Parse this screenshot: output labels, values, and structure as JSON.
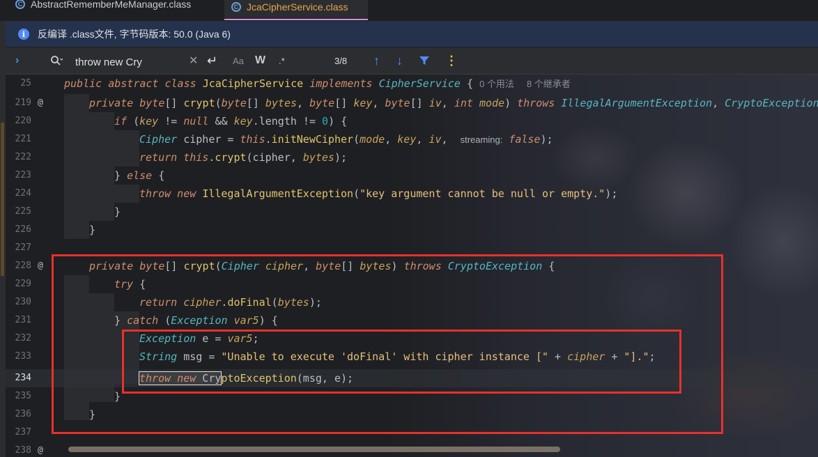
{
  "tabs": [
    {
      "label": "AbstractRememberMeManager.class",
      "icon": "class-file-icon"
    },
    {
      "label": "JcaCipherService.class",
      "icon": "class-file-icon",
      "active": true
    }
  ],
  "banner": {
    "text": "反编译 .class文件, 字节码版本: 50.0 (Java 6)",
    "icon": "info-icon"
  },
  "find": {
    "query": "throw new Cry",
    "match_case_label": "Aa",
    "words_label": "W",
    "regex_label": ".*",
    "counter": "3/8"
  },
  "colors": {
    "accent": "#548af7",
    "highlight_box": "#e8312b",
    "active_tab_underline": "#d08dd9"
  },
  "code": {
    "class_line": {
      "num": "25",
      "meta_usages": "0 个用法",
      "meta_inheritors": "8 个继承者"
    },
    "lines": [
      {
        "num": "219",
        "gutter": "@"
      },
      {
        "num": "220"
      },
      {
        "num": "221",
        "hint": "streaming:"
      },
      {
        "num": "222"
      },
      {
        "num": "223"
      },
      {
        "num": "224"
      },
      {
        "num": "225"
      },
      {
        "num": "226"
      },
      {
        "num": "227"
      },
      {
        "num": "228",
        "gutter": "@"
      },
      {
        "num": "229"
      },
      {
        "num": "230"
      },
      {
        "num": "231"
      },
      {
        "num": "232"
      },
      {
        "num": "233"
      },
      {
        "num": "234"
      },
      {
        "num": "235"
      },
      {
        "num": "236"
      },
      {
        "num": "237"
      },
      {
        "num": "238",
        "gutter": "@"
      }
    ]
  }
}
